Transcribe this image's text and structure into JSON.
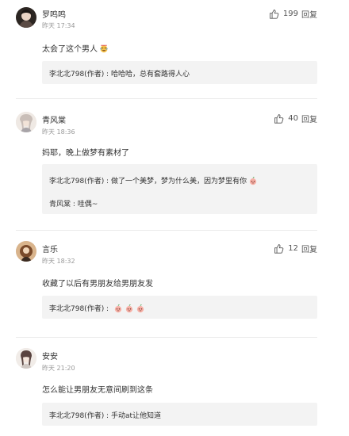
{
  "comments": [
    {
      "name": "罗鸣鸣",
      "time": "昨天 17:34",
      "likes": "199",
      "like_label": "回复",
      "text": "太会了这个男人",
      "text_emoji": "laugh-cry-emoji",
      "replies": [
        {
          "text": "李北北798(作者) : 哈哈哈，总有套路得人心",
          "emojis": []
        }
      ]
    },
    {
      "name": "青风棠",
      "time": "昨天 18:36",
      "likes": "40",
      "like_label": "回复",
      "text": "妈耶，晚上做梦有素材了",
      "replies": [
        {
          "text": "李北北798(作者) : 做了一个美梦，梦为什么美，因为梦里有你",
          "emojis": [
            "peach-emoji"
          ]
        },
        {
          "text": "青风棠 : 哇偶~",
          "emojis": []
        }
      ]
    },
    {
      "name": "言乐",
      "time": "昨天 18:32",
      "likes": "12",
      "like_label": "回复",
      "text": "收藏了以后有男朋友给男朋友发",
      "replies": [
        {
          "text": "李北北798(作者) :",
          "emojis": [
            "peach-emoji",
            "peach-emoji",
            "peach-emoji"
          ]
        }
      ]
    },
    {
      "name": "安安",
      "time": "昨天 21:20",
      "text": "怎么能让男朋友无意间刷到这条",
      "replies": [
        {
          "text": "李北北798(作者) : 手动at让他知道",
          "emojis": []
        }
      ]
    }
  ],
  "colors": {
    "meta": "#999999",
    "reply_bg": "#f3f3f3",
    "separator": "#eaeaea"
  }
}
